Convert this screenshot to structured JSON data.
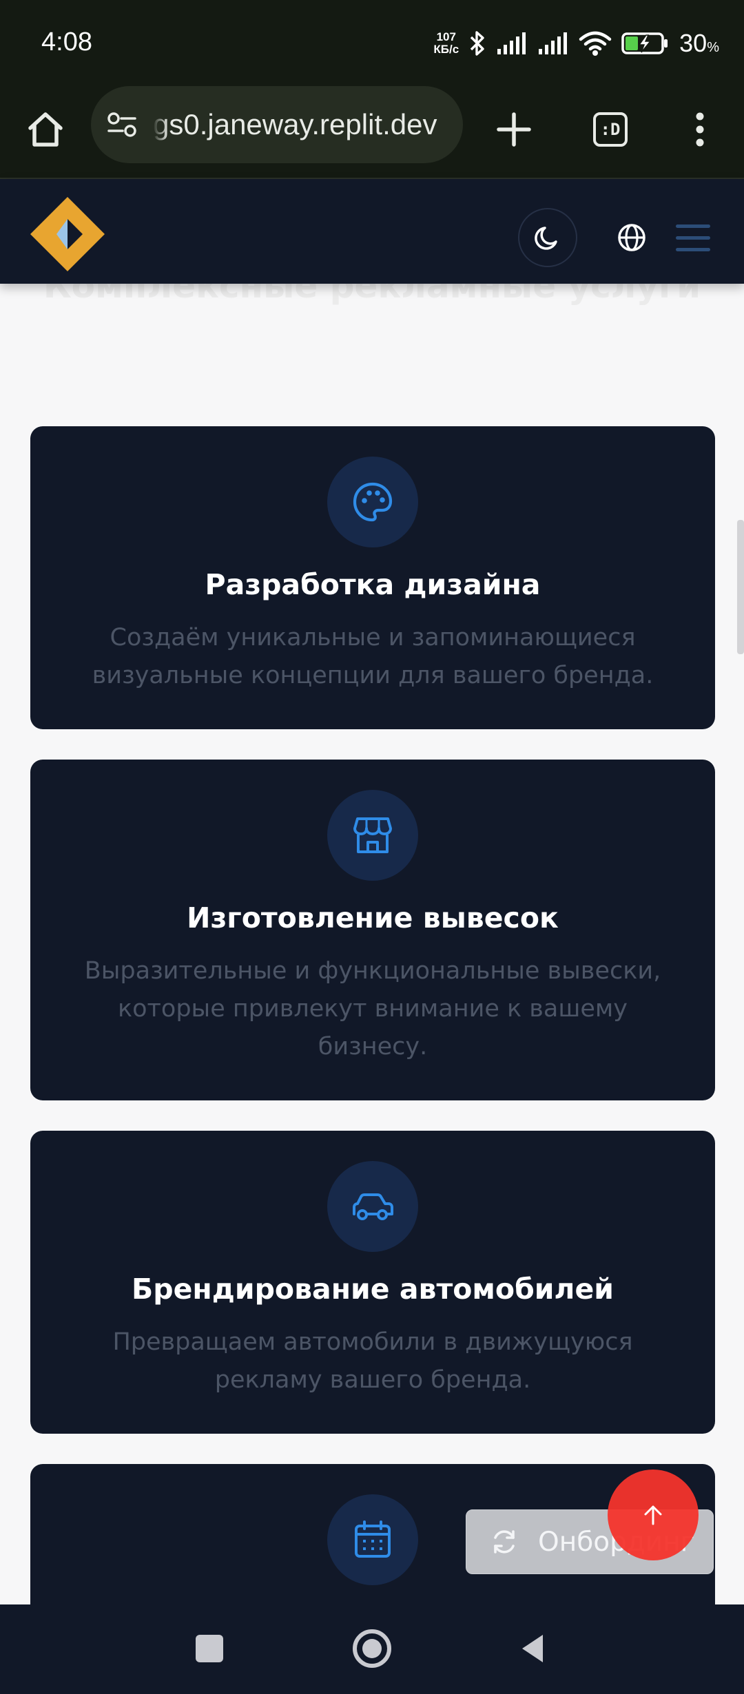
{
  "status_bar": {
    "time": "4:08",
    "net_speed_value": "107",
    "net_speed_unit": "КБ/с",
    "battery_percent": "30",
    "battery_percent_sign": "%",
    "icons": [
      "bluetooth-icon",
      "signal-icon",
      "signal-icon",
      "wifi-icon",
      "battery-charging-icon"
    ]
  },
  "browser": {
    "url": "gs0.janeway.replit.dev",
    "tab_count_glyph": ":D",
    "icons": [
      "home-icon",
      "site-settings-icon",
      "plus-icon",
      "tabs-icon",
      "more-vertical-icon"
    ]
  },
  "header": {
    "icons": [
      "logo-icon",
      "moon-icon",
      "globe-icon",
      "menu-icon"
    ],
    "colors": {
      "background": "#111828",
      "logo_orange": "#e8a530",
      "logo_blue": "#9bc4e8",
      "burger": "#2c4d78"
    }
  },
  "section": {
    "title": "Комплексные рекламные услуги"
  },
  "services": [
    {
      "icon": "palette-icon",
      "title": "Разработка дизайна",
      "description": "Создаём уникальные и запоминающиеся визуальные концепции для вашего бренда."
    },
    {
      "icon": "store-icon",
      "title": "Изготовление вывесок",
      "description": "Выразительные и функциональные вывески, которые привлекут внимание к вашему бизнесу."
    },
    {
      "icon": "car-icon",
      "title": "Брендирование автомобилей",
      "description": "Превращаем автомобили в движущуюся рекламу вашего бренда."
    },
    {
      "icon": "calendar-icon",
      "title": "",
      "description": ""
    }
  ],
  "floating": {
    "onboarding_label": "Онбординг",
    "onboarding_icon": "refresh-icon",
    "scroll_top_icon": "arrow-up-icon"
  },
  "colors": {
    "accent_blue": "#2f8ce8",
    "card_bg": "#111828",
    "icon_circle": "#17294a",
    "scroll_top_red": "#f4342c"
  }
}
